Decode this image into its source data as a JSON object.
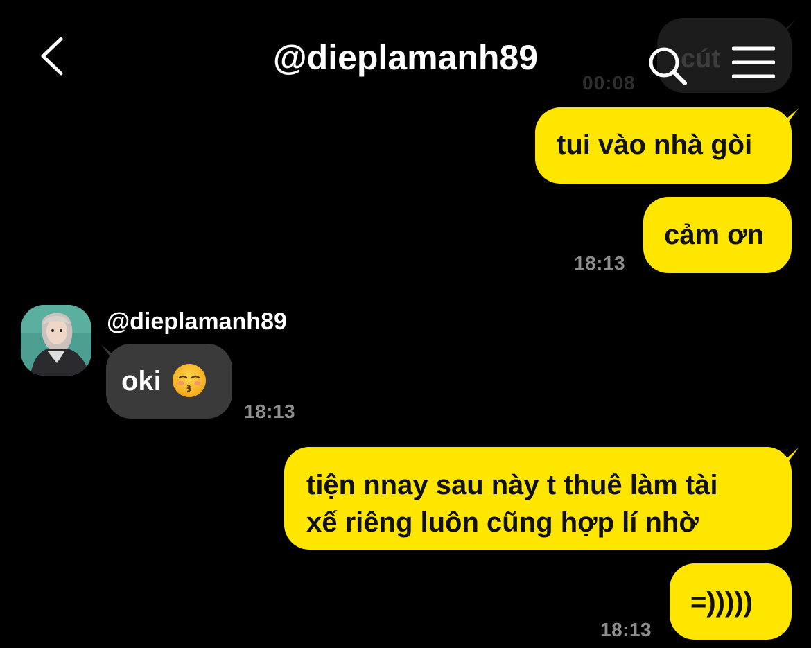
{
  "header": {
    "title": "@dieplamanh89"
  },
  "messages": [
    {
      "id": "m0",
      "text": "cút",
      "time": "00:08",
      "faded": true
    },
    {
      "id": "m1",
      "text": "tui vào nhà gòi"
    },
    {
      "id": "m2",
      "text": "cảm ơn",
      "time": "18:13"
    },
    {
      "id": "m3",
      "sender": "@dieplamanh89",
      "text": "oki",
      "emoji": "kissing-face-icon",
      "time": "18:13"
    },
    {
      "id": "m4",
      "lines": [
        "tiện nnay sau này t thuê làm tài",
        "xế riêng luôn cũng hợp lí nhờ"
      ]
    },
    {
      "id": "m5",
      "text": "=)))))",
      "time": "18:13"
    }
  ],
  "icons": [
    "back-icon",
    "search-icon",
    "menu-icon",
    "kissing-face-icon"
  ],
  "colors": {
    "background": "#000000",
    "outgoing_bubble": "#ffe600",
    "incoming_bubble": "#3a3a3a",
    "timestamp": "#8e8e8e"
  }
}
